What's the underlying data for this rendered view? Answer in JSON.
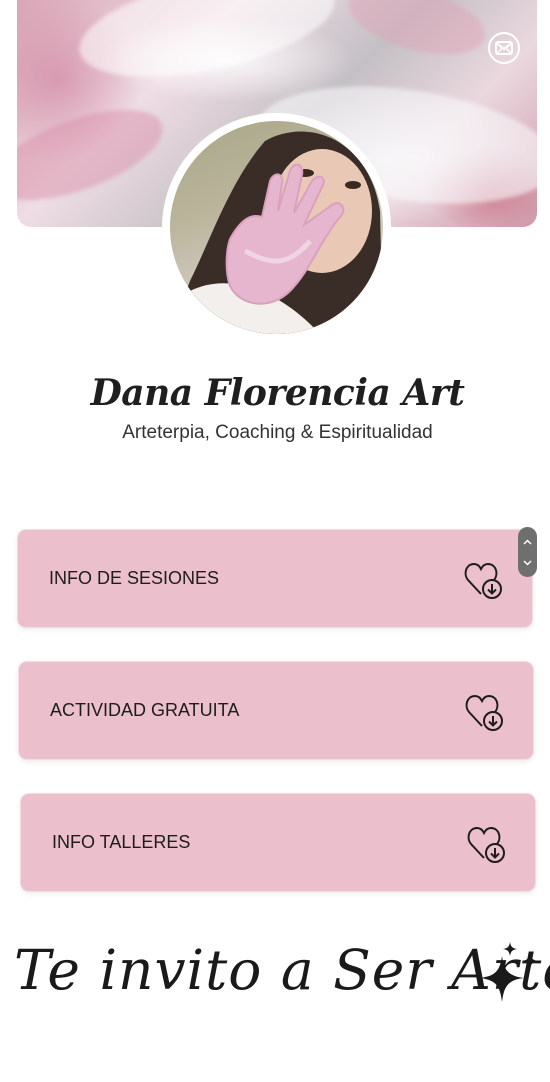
{
  "header": {
    "mail_icon": "mail-icon"
  },
  "profile": {
    "avatar_alt": "profile-photo",
    "name": "Dana Florencia Art",
    "tagline": "Arteterpia, Coaching & Espiritualidad"
  },
  "links": [
    {
      "label": "INFO DE SESIONES",
      "icon": "heart-download-icon"
    },
    {
      "label": "ACTIVIDAD GRATUITA",
      "icon": "heart-download-icon"
    },
    {
      "label": "INFO TALLERES",
      "icon": "heart-download-icon"
    }
  ],
  "motto": {
    "text": "Te invito a Ser Arte",
    "icon": "sparkle-icon"
  },
  "colors": {
    "card_background": "#ebbfcc",
    "text_dark": "#1d1d1d",
    "page_background": "#ffffff"
  }
}
